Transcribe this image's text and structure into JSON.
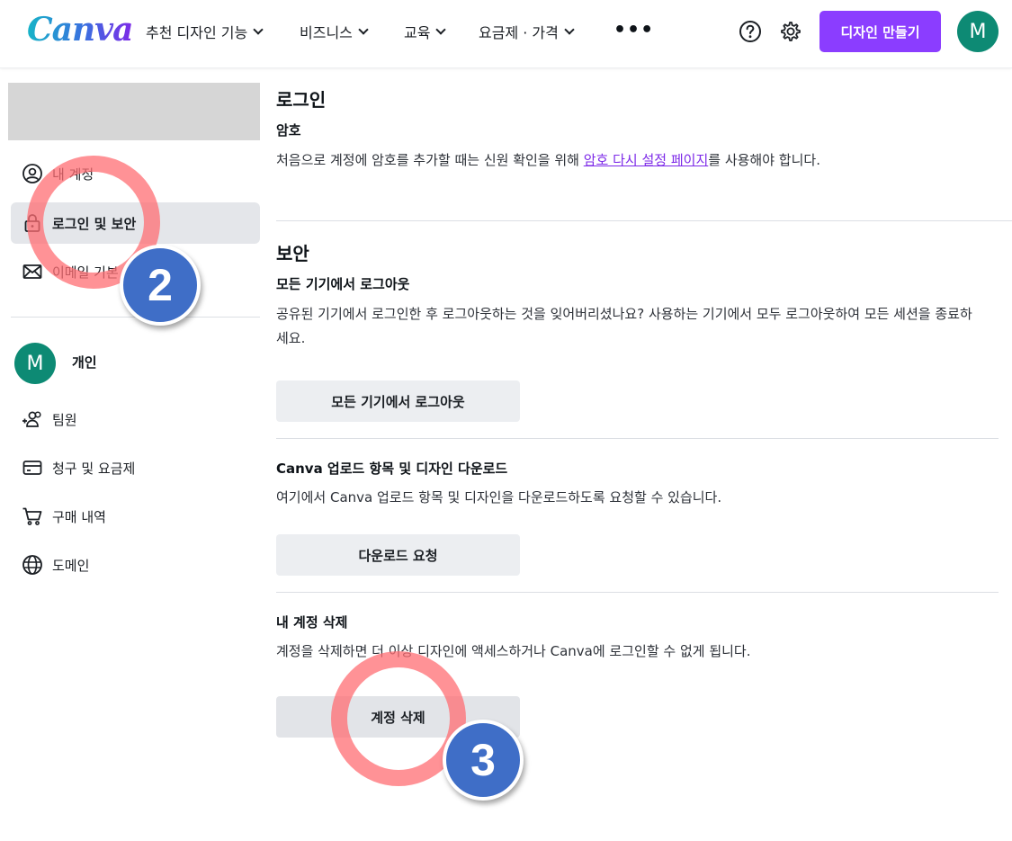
{
  "header": {
    "logo": "Canva",
    "nav": [
      {
        "label": "추천 디자인 기능"
      },
      {
        "label": "비즈니스"
      },
      {
        "label": "교육"
      },
      {
        "label": "요금제 · 가격"
      }
    ],
    "more": "•••",
    "create_button": "디자인 만들기",
    "avatar_initial": "M"
  },
  "sidebar": {
    "items": [
      {
        "label": "내 계정",
        "icon": "user-circle-icon"
      },
      {
        "label": "로그인 및 보안",
        "icon": "lock-icon",
        "active": true
      },
      {
        "label": "이메일 기본",
        "icon": "mail-icon"
      }
    ],
    "personal": {
      "avatar_initial": "M",
      "label": "개인"
    },
    "items2": [
      {
        "label": "팀원",
        "icon": "add-people-icon"
      },
      {
        "label": "청구 및 요금제",
        "icon": "credit-card-icon"
      },
      {
        "label": "구매 내역",
        "icon": "cart-icon"
      },
      {
        "label": "도메인",
        "icon": "globe-icon"
      }
    ]
  },
  "main": {
    "login": {
      "title": "로그인",
      "password_title": "암호",
      "password_text_before": "처음으로 계정에 암호를 추가할 때는 신원 확인을 위해 ",
      "password_link": "암호 다시 설정 페이지",
      "password_text_after": "를 사용해야 합니다."
    },
    "security": {
      "title": "보안",
      "logout_title": "모든 기기에서 로그아웃",
      "logout_text": "공유된 기기에서 로그인한 후 로그아웃하는 것을 잊어버리셨나요? 사용하는 기기에서 모두 로그아웃하여 모든 세션을 종료하세요.",
      "logout_button": "모든 기기에서 로그아웃",
      "download_title": "Canva 업로드 항목 및 디자인 다운로드",
      "download_text": "여기에서 Canva 업로드 항목 및 디자인을 다운로드하도록 요청할 수 있습니다.",
      "download_button": "다운로드 요청",
      "delete_title": "내 계정 삭제",
      "delete_text": "계정을 삭제하면 더 이상 디자인에 액세스하거나 Canva에 로그인할 수 없게 됩니다.",
      "delete_button": "계정 삭제"
    }
  },
  "annotations": {
    "step2": "2",
    "step3": "3",
    "ring_color": "#ff6e73",
    "badge_color": "#3f6ec7"
  },
  "colors": {
    "brand_purple": "#8b3dff",
    "avatar_green": "#0d8a74",
    "link_purple": "#7d2ae8"
  }
}
